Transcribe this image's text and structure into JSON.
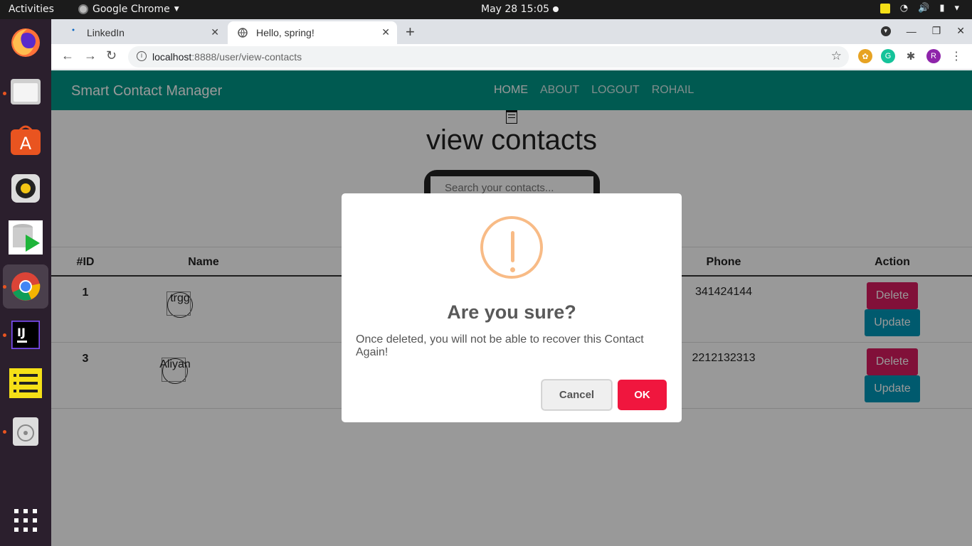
{
  "system": {
    "activities": "Activities",
    "app_name": "Google Chrome",
    "clock": "May 28  15:05"
  },
  "browser": {
    "tabs": [
      {
        "label": "LinkedIn",
        "active": false
      },
      {
        "label": "Hello, spring!",
        "active": true
      }
    ],
    "url_host": "localhost",
    "url_path": ":8888/user/view-contacts",
    "profile_initial": "R"
  },
  "app": {
    "brand": "Smart Contact Manager",
    "nav": [
      "HOME",
      "ABOUT",
      "LOGOUT",
      "ROHAIL"
    ],
    "page_title": "view contacts",
    "search_placeholder": "Search your contacts...",
    "table": {
      "headers": [
        "#ID",
        "Name",
        "Phone",
        "Action"
      ],
      "rows": [
        {
          "id": "1",
          "name": "trgg",
          "phone": "341424144"
        },
        {
          "id": "3",
          "name": "Aliyan",
          "phone": "2212132313"
        }
      ],
      "delete_label": "Delete",
      "update_label": "Update"
    }
  },
  "dialog": {
    "title": "Are you sure?",
    "text": "Once deleted, you will not be able to recover this Contact Again!",
    "cancel": "Cancel",
    "ok": "OK"
  },
  "colors": {
    "navbar": "#009688",
    "delete": "#d81b60",
    "update": "#0097b7",
    "warning": "#f8bb86",
    "ok_button": "#f0163e"
  }
}
